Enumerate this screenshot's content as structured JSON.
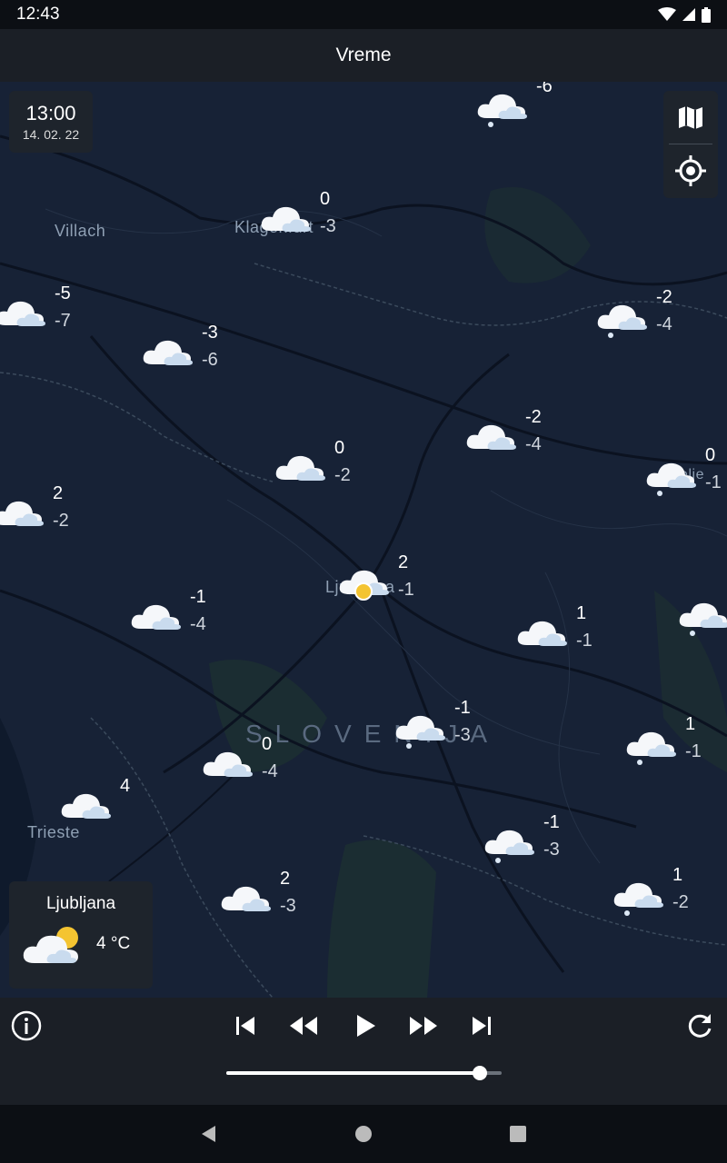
{
  "status": {
    "time": "12:43"
  },
  "app": {
    "title": "Vreme"
  },
  "time_box": {
    "time": "13:00",
    "date": "14. 02. 22"
  },
  "map": {
    "places": [
      {
        "name": "Villach"
      },
      {
        "name": "Klagenfurt"
      },
      {
        "name": "Ljubljana"
      },
      {
        "name": "Trieste"
      },
      {
        "name": "Celje"
      }
    ],
    "country_label": "SLOVENIJA",
    "forecasts": [
      {
        "max": "-6",
        "min": ""
      },
      {
        "max": "0",
        "min": "-3"
      },
      {
        "max": "-5",
        "min": "-7"
      },
      {
        "max": "-3",
        "min": "-6"
      },
      {
        "max": "-2",
        "min": "-4"
      },
      {
        "max": "-2",
        "min": "-4"
      },
      {
        "max": "0",
        "min": "-2"
      },
      {
        "max": "0",
        "min": "-1"
      },
      {
        "max": "2",
        "min": "-2"
      },
      {
        "max": "2",
        "min": "-1"
      },
      {
        "max": "-1",
        "min": "-4"
      },
      {
        "max": "1",
        "min": "-1"
      },
      {
        "max": "",
        "min": ""
      },
      {
        "max": "-1",
        "min": "-3"
      },
      {
        "max": "1",
        "min": "-1"
      },
      {
        "max": "0",
        "min": "-4"
      },
      {
        "max": "4",
        "min": ""
      },
      {
        "max": "-1",
        "min": "-3"
      },
      {
        "max": "2",
        "min": "-3"
      },
      {
        "max": "1",
        "min": "-2"
      }
    ]
  },
  "city_card": {
    "name": "Ljubljana",
    "temp": "4 °C"
  },
  "player": {
    "progress": 0.92
  },
  "colors": {
    "map_bg": "#172236",
    "bar_bg": "#1b1f26",
    "sun": "#f4c431"
  }
}
